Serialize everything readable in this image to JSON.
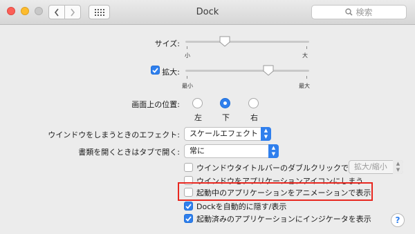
{
  "window": {
    "title": "Dock",
    "search_placeholder": "検索"
  },
  "icons": {
    "back": "chevron-left-icon",
    "forward": "chevron-right-icon",
    "grid": "grid-icon",
    "search": "search-icon",
    "help": "help-icon"
  },
  "size": {
    "label": "サイズ:",
    "min_label": "小",
    "max_label": "大",
    "value_fraction": 0.33
  },
  "magnification": {
    "label": "拡大:",
    "checked": true,
    "min_label": "最小",
    "max_label": "最大",
    "value_fraction": 0.68
  },
  "position": {
    "label": "画面上の位置:",
    "options": [
      {
        "label": "左",
        "selected": false
      },
      {
        "label": "下",
        "selected": true
      },
      {
        "label": "右",
        "selected": false
      }
    ]
  },
  "minimize_effect": {
    "label": "ウインドウをしまうときのエフェクト:",
    "value": "スケールエフェクト"
  },
  "tabs_pref": {
    "label": "書類を開くときはタブで開く:",
    "value": "常に"
  },
  "titlebar_double_click": {
    "label": "ウインドウタイトルバーのダブルクリックで",
    "checked": false,
    "value": "拡大/縮小"
  },
  "checkboxes": [
    {
      "label": "ウインドウをアプリケーションアイコンにしまう",
      "checked": false
    },
    {
      "label": "起動中のアプリケーションをアニメーションで表示",
      "checked": false
    },
    {
      "label": "Dockを自動的に隠す/表示",
      "checked": true
    },
    {
      "label": "起動済みのアプリケーションにインジケータを表示",
      "checked": true
    }
  ],
  "colors": {
    "accent": "#2f7fed",
    "highlight": "#e8271f"
  }
}
